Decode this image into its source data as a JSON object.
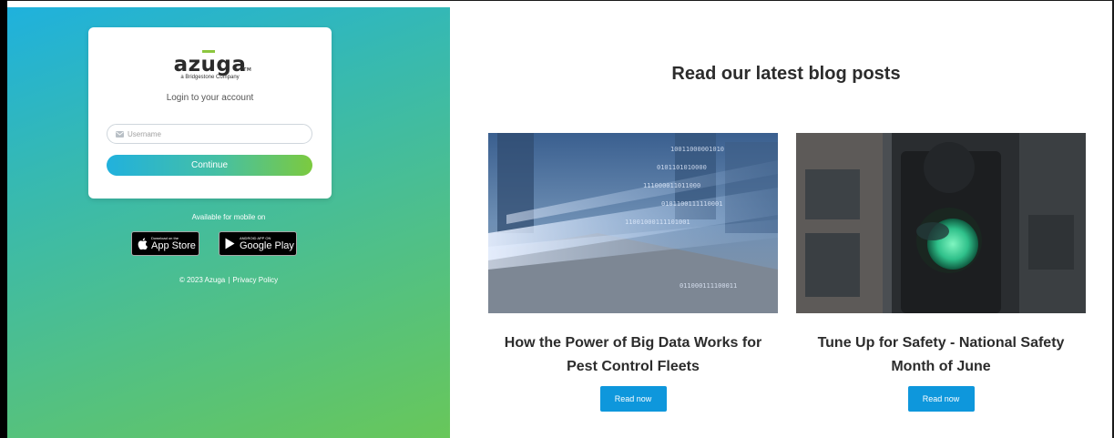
{
  "login": {
    "logo_text_a": "az",
    "logo_text_u": "u",
    "logo_text_b": "ga",
    "logo_tm": "TM",
    "logo_subtitle": "a Bridgestone Company",
    "title": "Login to your account",
    "username_placeholder": "Username",
    "continue_label": "Continue"
  },
  "mobile": {
    "label": "Available for mobile on",
    "app_store_small": "Download on the",
    "app_store_big": "App Store",
    "google_play_small": "ANDROID APP ON",
    "google_play_big": "Google Play"
  },
  "footer": {
    "copyright": "© 2023 Azuga",
    "separator": "|",
    "privacy_label": "Privacy Policy"
  },
  "blog": {
    "heading": "Read our latest blog posts",
    "posts": [
      {
        "title": "How the Power of Big Data Works for Pest Control Fleets",
        "button": "Read now",
        "image": "big-data-highway-image"
      },
      {
        "title": "Tune Up for Safety - National Safety Month of June",
        "button": "Read now",
        "image": "green-traffic-light-image"
      }
    ]
  },
  "colors": {
    "brand_green": "#8cc63f",
    "brand_blue": "#21b1dd",
    "button_blue": "#0e97dc"
  }
}
